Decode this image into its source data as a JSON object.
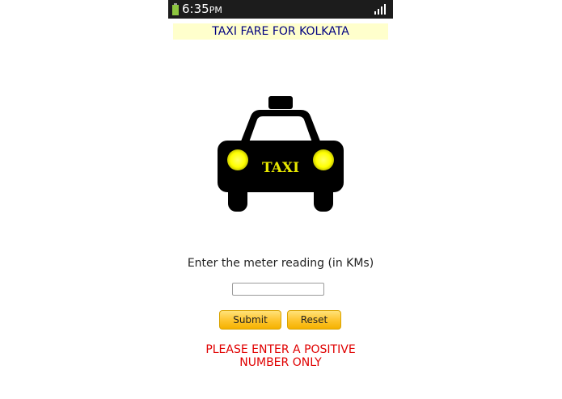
{
  "status_bar": {
    "time": "6:35",
    "ampm": "PM",
    "battery_color": "#8dc63f"
  },
  "header": {
    "title": "TAXI FARE FOR KOLKATA"
  },
  "taxi_image": {
    "sign_text": "TAXI",
    "body_color": "#000000",
    "light_color": "#ffff00"
  },
  "form": {
    "prompt": "Enter the meter reading (in KMs)",
    "input_value": "",
    "submit_label": "Submit",
    "reset_label": "Reset"
  },
  "error_message": "PLEASE ENTER A POSITIVE NUMBER ONLY",
  "colors": {
    "error": "#e00000",
    "title_bg": "#ffffcc",
    "title_text": "#000080",
    "button_accent": "#fdc42c"
  }
}
